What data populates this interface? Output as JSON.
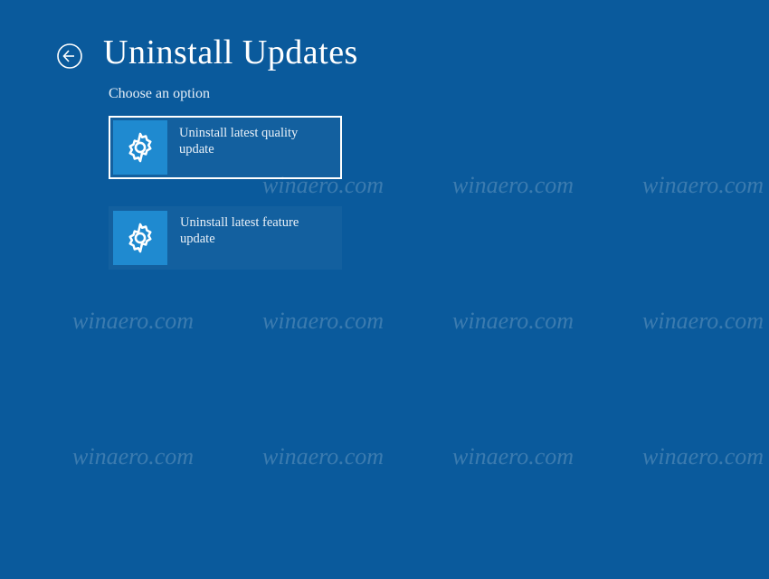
{
  "header": {
    "title": "Uninstall Updates",
    "subtitle": "Choose an option"
  },
  "options": [
    {
      "label": "Uninstall latest quality update",
      "selected": true
    },
    {
      "label": "Uninstall latest feature update",
      "selected": false
    }
  ],
  "watermark": {
    "text": "winaero.com"
  },
  "colors": {
    "background": "#0a5a9c",
    "tile_accent": "#1f8ad0"
  }
}
